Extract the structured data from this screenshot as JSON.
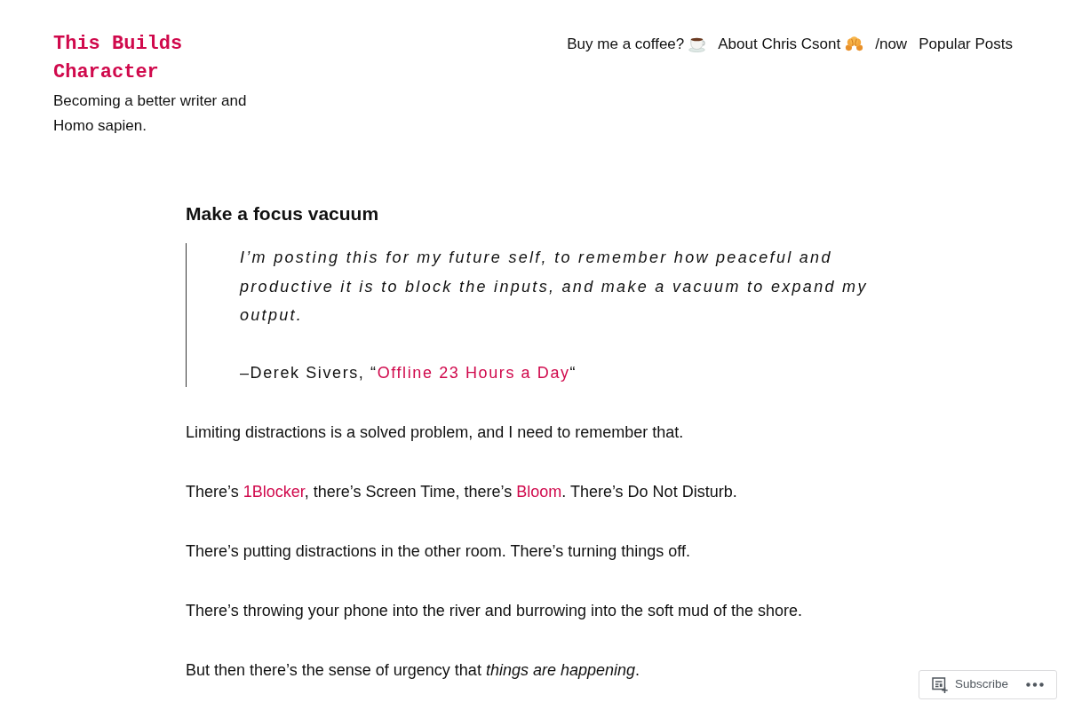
{
  "site": {
    "title": "This Builds Character",
    "tagline": "Becoming a better writer and Homo sapien."
  },
  "nav": [
    {
      "label": "Buy me a coffee?"
    },
    {
      "label": "About Chris Csont"
    },
    {
      "label": "/now"
    },
    {
      "label": "Popular Posts"
    }
  ],
  "post": {
    "title": "Make a focus vacuum",
    "quote": {
      "text": "I’m posting this for my future self, to remember how peaceful and productive it is to block the inputs, and make a vacuum to expand my output.",
      "attribution": [
        {
          "kind": "text",
          "text": "–Derek Sivers, “"
        },
        {
          "kind": "link",
          "text": "Offline 23 Hours a Day"
        },
        {
          "kind": "text",
          "text": "“"
        }
      ]
    },
    "paragraphs": [
      [
        {
          "kind": "text",
          "text": "Limiting distractions is a solved problem, and I need to remember that."
        }
      ],
      [
        {
          "kind": "text",
          "text": "There’s "
        },
        {
          "kind": "link",
          "text": "1Blocker"
        },
        {
          "kind": "text",
          "text": ", there’s Screen Time, there’s "
        },
        {
          "kind": "link",
          "text": "Bloom"
        },
        {
          "kind": "text",
          "text": ". There’s Do Not Disturb."
        }
      ],
      [
        {
          "kind": "text",
          "text": "There’s putting distractions in the other room. There’s turning things off."
        }
      ],
      [
        {
          "kind": "text",
          "text": "There’s throwing your phone into the river and burrowing into the soft mud of the shore."
        }
      ],
      [
        {
          "kind": "text",
          "text": "But then there’s the sense of urgency that *things are happening*."
        }
      ]
    ]
  },
  "subscribe_bar": {
    "label": "Subscribe"
  }
}
